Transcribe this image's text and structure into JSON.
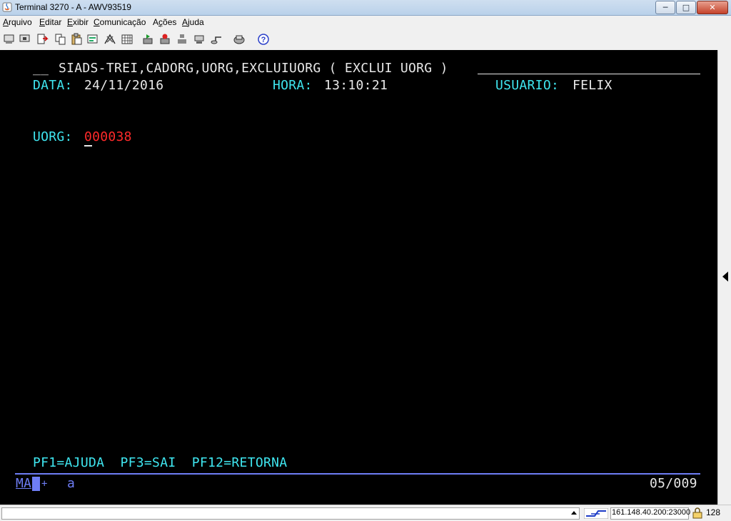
{
  "window": {
    "title": "Terminal 3270 - A - AWV93519",
    "controls": {
      "minimize": "─",
      "maximize": "□",
      "close": "✕"
    }
  },
  "menu": {
    "items": [
      {
        "key": "A",
        "rest": "rquivo"
      },
      {
        "key": "E",
        "rest": "ditar"
      },
      {
        "key": "E",
        "rest": "xibir"
      },
      {
        "key": "C",
        "rest": "omunicação"
      },
      {
        "key": "",
        "pre": "A",
        "keymid": "ç",
        "rest": "ões"
      },
      {
        "key": "A",
        "rest": "juda"
      }
    ]
  },
  "toolbar": {
    "icons": [
      "print-screen-icon",
      "print-setup-icon",
      "send-file-icon",
      "copy-icon",
      "paste-icon",
      "paste-special-icon",
      "macro-icon",
      "keypad-icon",
      "connect-icon",
      "disconnect-icon",
      "session-icon",
      "settings-icon",
      "transfer-icon",
      "help-icon"
    ]
  },
  "screen": {
    "header_prefix": "__",
    "header_title": "SIADS-TREI,CADORG,UORG,EXCLUIUORG ( EXCLUI UORG )",
    "data_label": "DATA:",
    "data_value": "24/11/2016",
    "hora_label": "HORA:",
    "hora_value": "13:10:21",
    "usuario_label": "USUARIO:",
    "usuario_value": "FELIX",
    "uorg_label": "UORG:",
    "uorg_value": "000038",
    "pfkeys": "PF1=AJUDA  PF3=SAI  PF12=RETORNA"
  },
  "oia": {
    "ma_left": "M",
    "ma_right": "A",
    "plus": "+",
    "input_mode": "a",
    "cursor_position": "05/009"
  },
  "statusbar": {
    "host": "161.148.40.200:23000",
    "code": "128"
  },
  "colors": {
    "terminal_bg": "#000000",
    "cyan": "#3fe6f0",
    "white": "#e8e8e8",
    "red": "#ff2a2a",
    "blue": "#6e7df5"
  }
}
